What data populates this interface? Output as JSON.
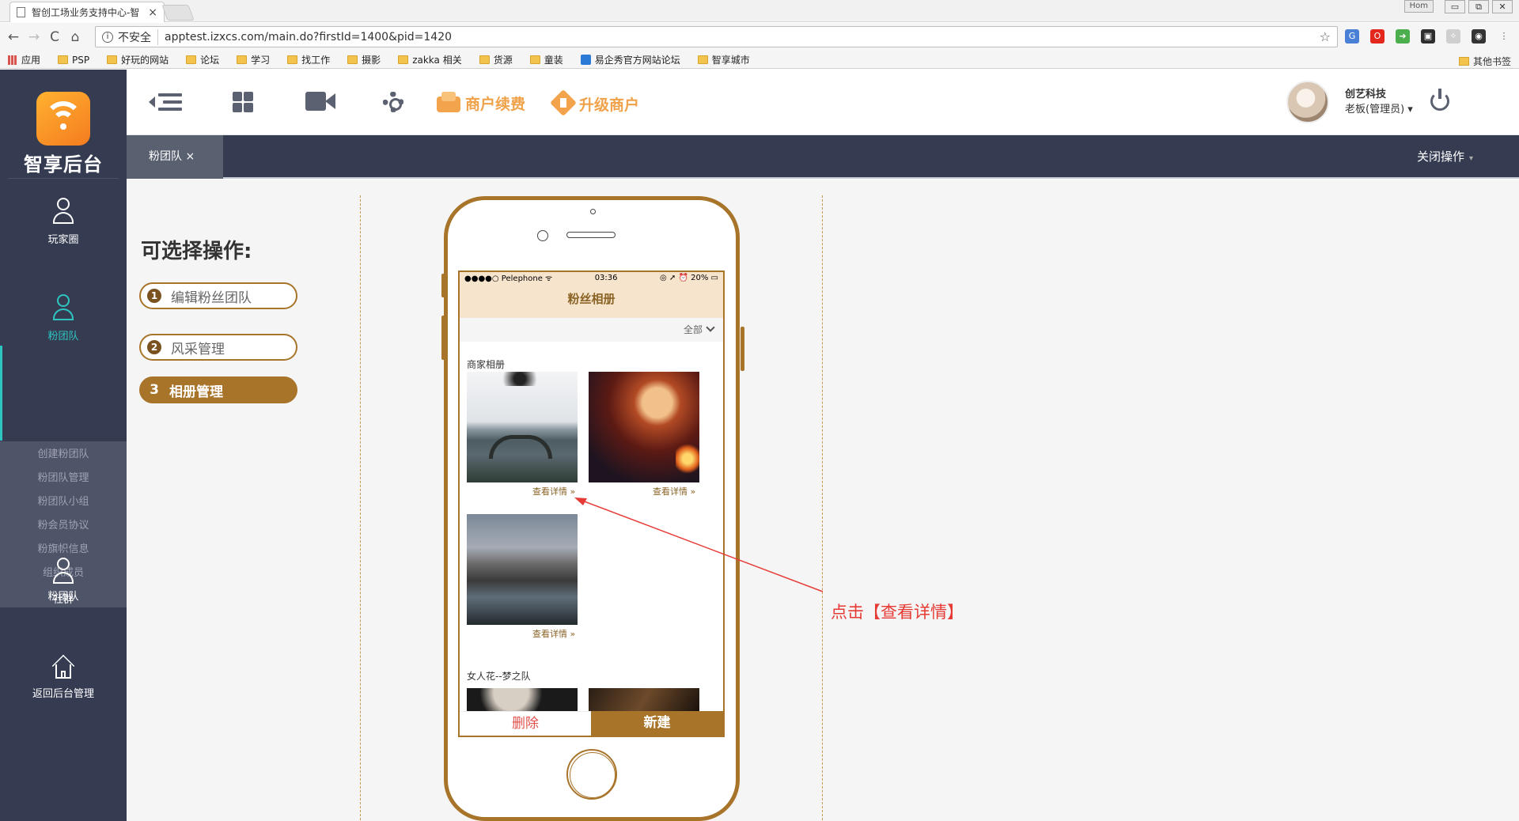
{
  "browser": {
    "tab_title": "智创工场业务支持中心-智",
    "tab_close": "×",
    "user_badge": "Hom",
    "window_buttons": [
      "▭",
      "⧉",
      "✕"
    ],
    "security_label": "不安全",
    "url": "apptest.izxcs.com/main.do?firstId=1400&pid=1420",
    "nav": {
      "back": "←",
      "forward": "→",
      "reload": "C",
      "home": "⌂",
      "info": "i",
      "star": "☆"
    },
    "extensions": [
      {
        "name": "translate-extension-icon",
        "color": "#4a7fd6",
        "glyph": "G"
      },
      {
        "name": "opera-extension-icon",
        "color": "#e3271d",
        "glyph": "O"
      },
      {
        "name": "arrow-extension-icon",
        "color": "#4cae4c",
        "glyph": "➜"
      },
      {
        "name": "monitor-extension-icon",
        "color": "#2e2e2e",
        "glyph": "▣"
      },
      {
        "name": "puzzle-extension-icon",
        "color": "#cfcfcf",
        "glyph": "✧"
      },
      {
        "name": "ghost-extension-icon",
        "color": "#333333",
        "glyph": "◉"
      },
      {
        "name": "menu-icon",
        "color": "#f5f5f5",
        "glyph": "⋮"
      }
    ],
    "bookmarks": [
      "应用",
      "PSP",
      "好玩的网站",
      "论坛",
      "学习",
      "找工作",
      "摄影",
      "zakka 相关",
      "货源",
      "童装",
      "易企秀官方网站论坛",
      "智享城市"
    ],
    "bookmarks_other": "其他书签"
  },
  "app": {
    "logo_text": "智享后台",
    "brand_color": "#f5a623",
    "accent_color": "#2ec4c0",
    "sidebar": {
      "items": [
        {
          "label": "玩家圈",
          "icon": "user-icon"
        },
        {
          "label": "粉团队",
          "icon": "user-icon",
          "active": true
        },
        {
          "label": "社群",
          "icon": "user-icon"
        },
        {
          "label": "返回后台管理",
          "icon": "home-icon"
        }
      ],
      "submenu": [
        "创建粉团队",
        "粉团队管理",
        "粉团队小组",
        "粉会员协议",
        "粉旗帜信息",
        "组织成员",
        "粉团队"
      ]
    },
    "toolbar": {
      "renew_label": "商户续费",
      "upgrade_label": "升级商户"
    },
    "user": {
      "name": "创艺科技",
      "role": "老板(管理员)",
      "caret": "▾"
    },
    "tabbar": {
      "current_tab": "粉团队 ×",
      "close_ops": "关闭操作",
      "caret": "▾"
    },
    "operations": {
      "title": "可选择操作:",
      "items": [
        {
          "num": "1",
          "label": "编辑粉丝团队"
        },
        {
          "num": "2",
          "label": "风采管理"
        },
        {
          "num": "3",
          "label": "相册管理",
          "selected": true
        }
      ]
    },
    "phone": {
      "status": {
        "carrier": "●●●●○ Pelephone ᯤ",
        "time": "03:36",
        "battery": "◎ ➚ ⏰ 20% ▭"
      },
      "title": "粉丝相册",
      "filter": "全部",
      "groups": [
        {
          "title": "商家相册",
          "details": [
            "查看详情 »",
            "查看详情 »",
            "查看详情 »"
          ]
        },
        {
          "title": "女人花--梦之队"
        }
      ],
      "delete_label": "删除",
      "new_label": "新建"
    },
    "annotation": {
      "text": "点击【查看详情】",
      "color": "#e63a35"
    }
  }
}
